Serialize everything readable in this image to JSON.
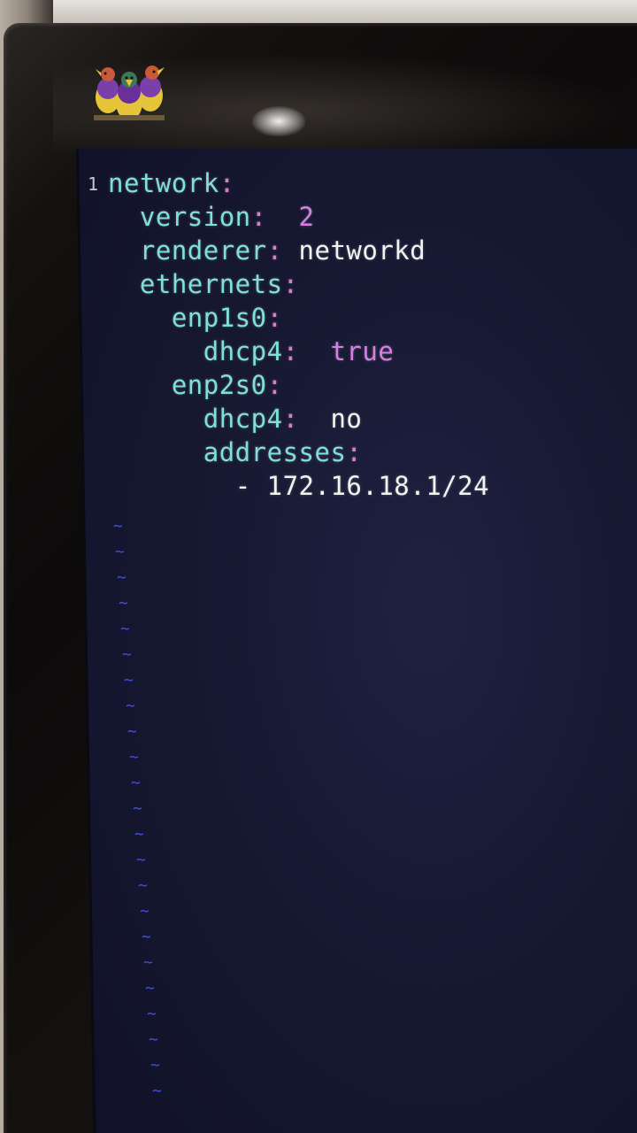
{
  "editor": {
    "line_number": "1",
    "lines": [
      {
        "indent": "",
        "key": "network",
        "colon": ":",
        "value": "",
        "value_type": "none"
      },
      {
        "indent": "  ",
        "key": "version",
        "colon": ":",
        "value": "  2",
        "value_type": "num"
      },
      {
        "indent": "  ",
        "key": "renderer",
        "colon": ":",
        "value": " networkd",
        "value_type": "str"
      },
      {
        "indent": "  ",
        "key": "ethernets",
        "colon": ":",
        "value": "",
        "value_type": "none"
      },
      {
        "indent": "    ",
        "key": "enp1s0",
        "colon": ":",
        "value": "",
        "value_type": "none"
      },
      {
        "indent": "      ",
        "key": "dhcp4",
        "colon": ":",
        "value": "  true",
        "value_type": "bool"
      },
      {
        "indent": "    ",
        "key": "enp2s0",
        "colon": ":",
        "value": "",
        "value_type": "none"
      },
      {
        "indent": "      ",
        "key": "dhcp4",
        "colon": ":",
        "value": "  no",
        "value_type": "str"
      },
      {
        "indent": "      ",
        "key": "addresses",
        "colon": ":",
        "value": "",
        "value_type": "none"
      },
      {
        "indent": "        ",
        "key": "",
        "colon": "",
        "value": "- 172.16.18.1/24",
        "value_type": "str"
      }
    ],
    "empty_line_marker": "~",
    "empty_line_count": 23
  },
  "colors": {
    "key": "#7fe0d6",
    "colon": "#e07ac8",
    "value_literal": "#d77fe0",
    "value_text": "#f2f2ee",
    "tilde": "#3f4fe6",
    "screen_bg": "#171933"
  },
  "icons": {
    "logo": "three-birds-logo-icon"
  }
}
